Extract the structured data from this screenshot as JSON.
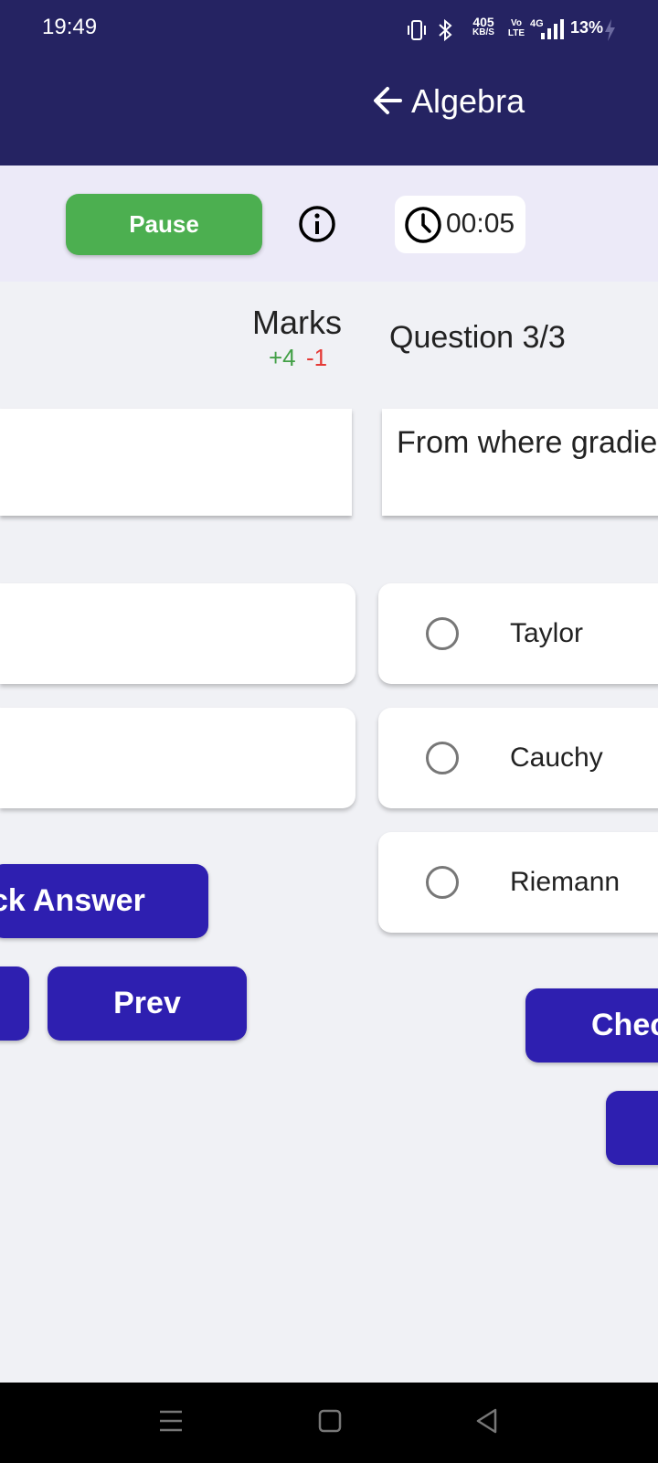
{
  "status_bar": {
    "time": "19:49",
    "net_speed_top": "405",
    "net_speed_bottom": "KB/S",
    "volte_top": "Vo",
    "volte_bottom": "LTE",
    "network": "4G",
    "battery": "13%"
  },
  "app_bar": {
    "title": "Algebra",
    "back_icon": "arrow-left-icon"
  },
  "controls": {
    "pause_label": "Pause",
    "timer": "00:05",
    "pause_color": "#4caf50"
  },
  "marks": {
    "label": "Marks",
    "positive": "+4",
    "negative": "-1"
  },
  "question": {
    "counter": "Question 3/3",
    "text": "From where gradie",
    "options": [
      "Taylor",
      "Cauchy",
      "Riemann"
    ]
  },
  "left_panel": {
    "check_label": "ck Answer",
    "prev_label": "Prev"
  },
  "right_panel": {
    "check_label": "Chec"
  },
  "colors": {
    "primary": "#252362",
    "button": "#2e1fb0",
    "positive": "#43a047",
    "negative": "#e53935"
  }
}
